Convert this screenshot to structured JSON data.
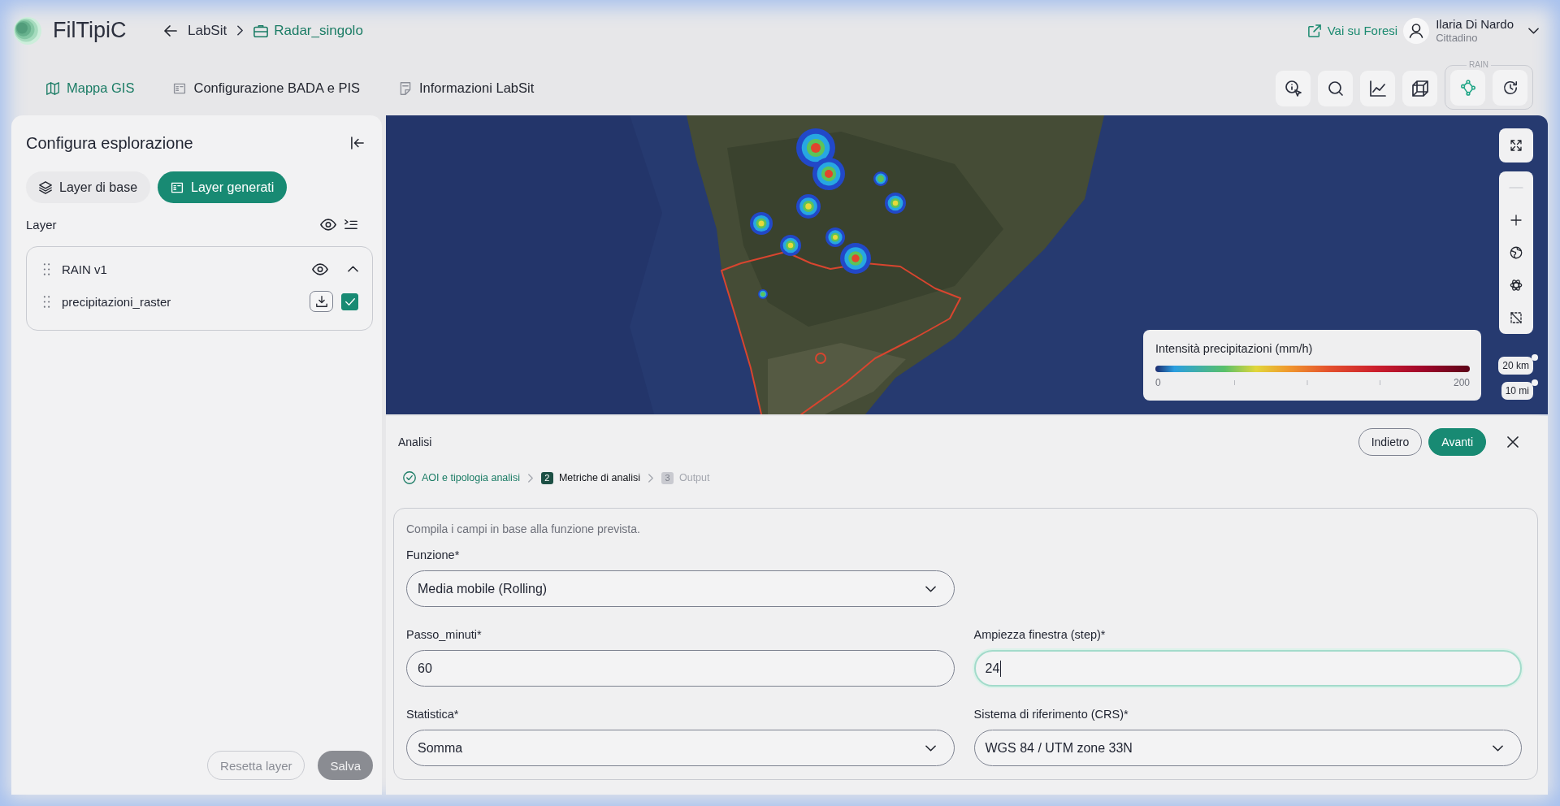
{
  "header": {
    "app_name": "FilTipiC",
    "breadcrumb": [
      {
        "label": "LabSit",
        "kind": "parent"
      },
      {
        "label": "Radar_singolo",
        "kind": "current"
      }
    ],
    "external_link": "Vai su Foresi",
    "user": {
      "name": "Ilaria Di Nardo",
      "role": "Cittadino"
    }
  },
  "nav_tabs": [
    {
      "label": "Mappa GIS",
      "selected": true
    },
    {
      "label": "Configurazione BADA e PIS",
      "selected": false
    },
    {
      "label": "Informazioni LabSit",
      "selected": false
    }
  ],
  "toolbar": {
    "tools": [
      {
        "selected": false
      },
      {
        "selected": false
      },
      {
        "selected": false
      },
      {
        "selected": false
      }
    ],
    "group": {
      "label": "RAIN",
      "tools": [
        {
          "selected": true
        },
        {
          "selected": false
        }
      ]
    }
  },
  "sidebar": {
    "title": "Configura esplorazione",
    "tabs": [
      {
        "label": "Layer di base",
        "selected": false
      },
      {
        "label": "Layer generati",
        "selected": true
      }
    ],
    "section_label": "Layer",
    "layer_groups": [
      {
        "name": "RAIN v1",
        "expanded": true,
        "children": [
          {
            "name": "precipitazioni_raster",
            "checked": true
          }
        ]
      }
    ],
    "buttons": [
      {
        "label": "Resetta layer",
        "kind": "outline",
        "disabled": true
      },
      {
        "label": "Salva",
        "kind": "filled",
        "disabled": true
      }
    ]
  },
  "map": {
    "controls": [
      {
        "disabled": false
      },
      {
        "disabled": true
      },
      {
        "disabled": false
      },
      {
        "disabled": false
      },
      {
        "disabled": false
      },
      {
        "disabled": false
      }
    ],
    "legend": {
      "title": "Intensità precipitazioni (mm/h)",
      "min_label": "0",
      "max_label": "200"
    },
    "scale": [
      "20 km",
      "10 mi"
    ]
  },
  "analysis": {
    "title": "Analisi",
    "buttons": [
      {
        "label": "Indietro",
        "kind": "outline"
      },
      {
        "label": "Avanti",
        "kind": "primary"
      }
    ],
    "steps": [
      {
        "label": "AOI e tipologia analisi",
        "completed": true,
        "selected": false
      },
      {
        "number": "2",
        "label": "Metriche di analisi",
        "completed": false,
        "selected": true
      },
      {
        "number": "3",
        "label": "Output",
        "completed": false,
        "selected": false
      }
    ]
  },
  "form": {
    "hint": "Compila i campi in base alla funzione prevista.",
    "rows": [
      [
        {
          "label": "Funzione*",
          "value": "Media mobile (Rolling)",
          "kind": "select",
          "focused": false
        }
      ],
      [
        {
          "label": "Passo_minuti*",
          "value": "60",
          "kind": "text",
          "focused": false
        },
        {
          "label": "Ampiezza finestra (step)*",
          "value": "24",
          "kind": "text",
          "focused": true
        }
      ],
      [
        {
          "label": "Statistica*",
          "value": "Somma",
          "kind": "select",
          "focused": false
        },
        {
          "label": "Sistema di riferimento (CRS)*",
          "value": "WGS 84 / UTM zone 33N",
          "kind": "select",
          "focused": false
        }
      ]
    ]
  }
}
